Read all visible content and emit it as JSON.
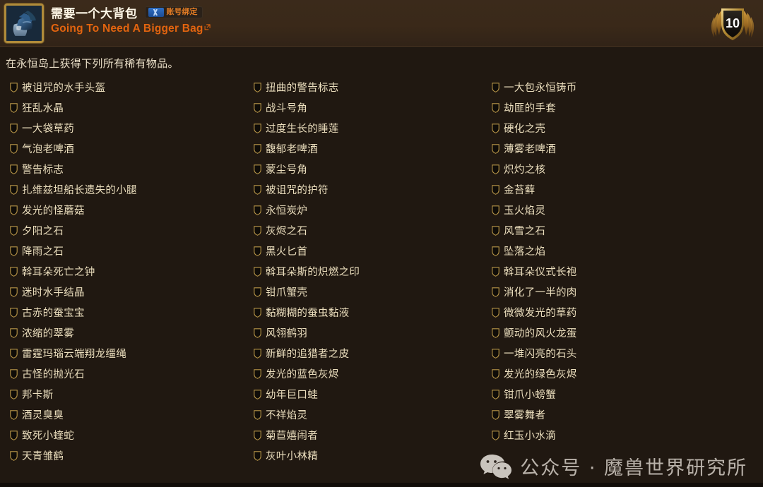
{
  "header": {
    "icon_name": "bag-icon",
    "title": "需要一个大背包",
    "bind_badge": {
      "logo": "battlenet-logo",
      "label": "账号绑定"
    },
    "subtitle": "Going To Need A Bigger Bag",
    "external_link_icon": "external-link-icon",
    "points": "10",
    "points_badge_icon": "achievement-shield-badge"
  },
  "description": "在永恒岛上获得下列所有稀有物品。",
  "criteria": {
    "columns": [
      {
        "items": [
          "被诅咒的水手头盔",
          "狂乱水晶",
          "一大袋草药",
          "气泡老啤酒",
          "警告标志",
          "扎维兹坦船长遗失的小腿",
          "发光的怪蘑菇",
          "夕阳之石",
          "降雨之石",
          "斡耳朵死亡之钟",
          "迷时水手结晶",
          "古赤的蚕宝宝",
          "浓缩的翠雾",
          "雷霆玛瑙云端翔龙缰绳",
          "古怪的抛光石",
          "邦卡斯",
          "酒灵臭臭",
          "致死小蝰蛇",
          "天青雏鹤"
        ]
      },
      {
        "items": [
          "扭曲的警告标志",
          "战斗号角",
          "过度生长的睡莲",
          "馥郁老啤酒",
          "蒙尘号角",
          "被诅咒的护符",
          "永恒炭炉",
          "灰烬之石",
          "黑火匕首",
          "斡耳朵斯的炽燃之印",
          "钳爪蟹壳",
          "黏糊糊的蚕虫黏液",
          "风翎鹤羽",
          "新鲜的追猎者之皮",
          "发光的蓝色灰烬",
          "幼年巨口蛙",
          "不祥焰灵",
          "菊苣嬉闹者",
          "灰叶小林精"
        ]
      },
      {
        "items": [
          "一大包永恒铸币",
          "劫匪的手套",
          "硬化之壳",
          "薄雾老啤酒",
          "炽灼之核",
          "金苔藓",
          "玉火焰灵",
          "风雪之石",
          "坠落之焰",
          "斡耳朵仪式长袍",
          "消化了一半的肉",
          "微微发光的草药",
          "颤动的风火龙蛋",
          "一堆闪亮的石头",
          "发光的绿色灰烬",
          "钳爪小螃蟹",
          "翠雾舞者",
          "红玉小水滴"
        ]
      }
    ]
  },
  "watermark": {
    "icon": "wechat-icon",
    "text": "公众号 · 魔兽世界研究所"
  },
  "colors": {
    "header_bg": "#3a2919",
    "body_bg": "#201811",
    "title_text": "#fdf6e6",
    "subtitle_link": "#e2640f",
    "criteria_text": "#ecdfbe",
    "shield_gold": "#b08b3a",
    "badge_label": "#e07b24"
  }
}
